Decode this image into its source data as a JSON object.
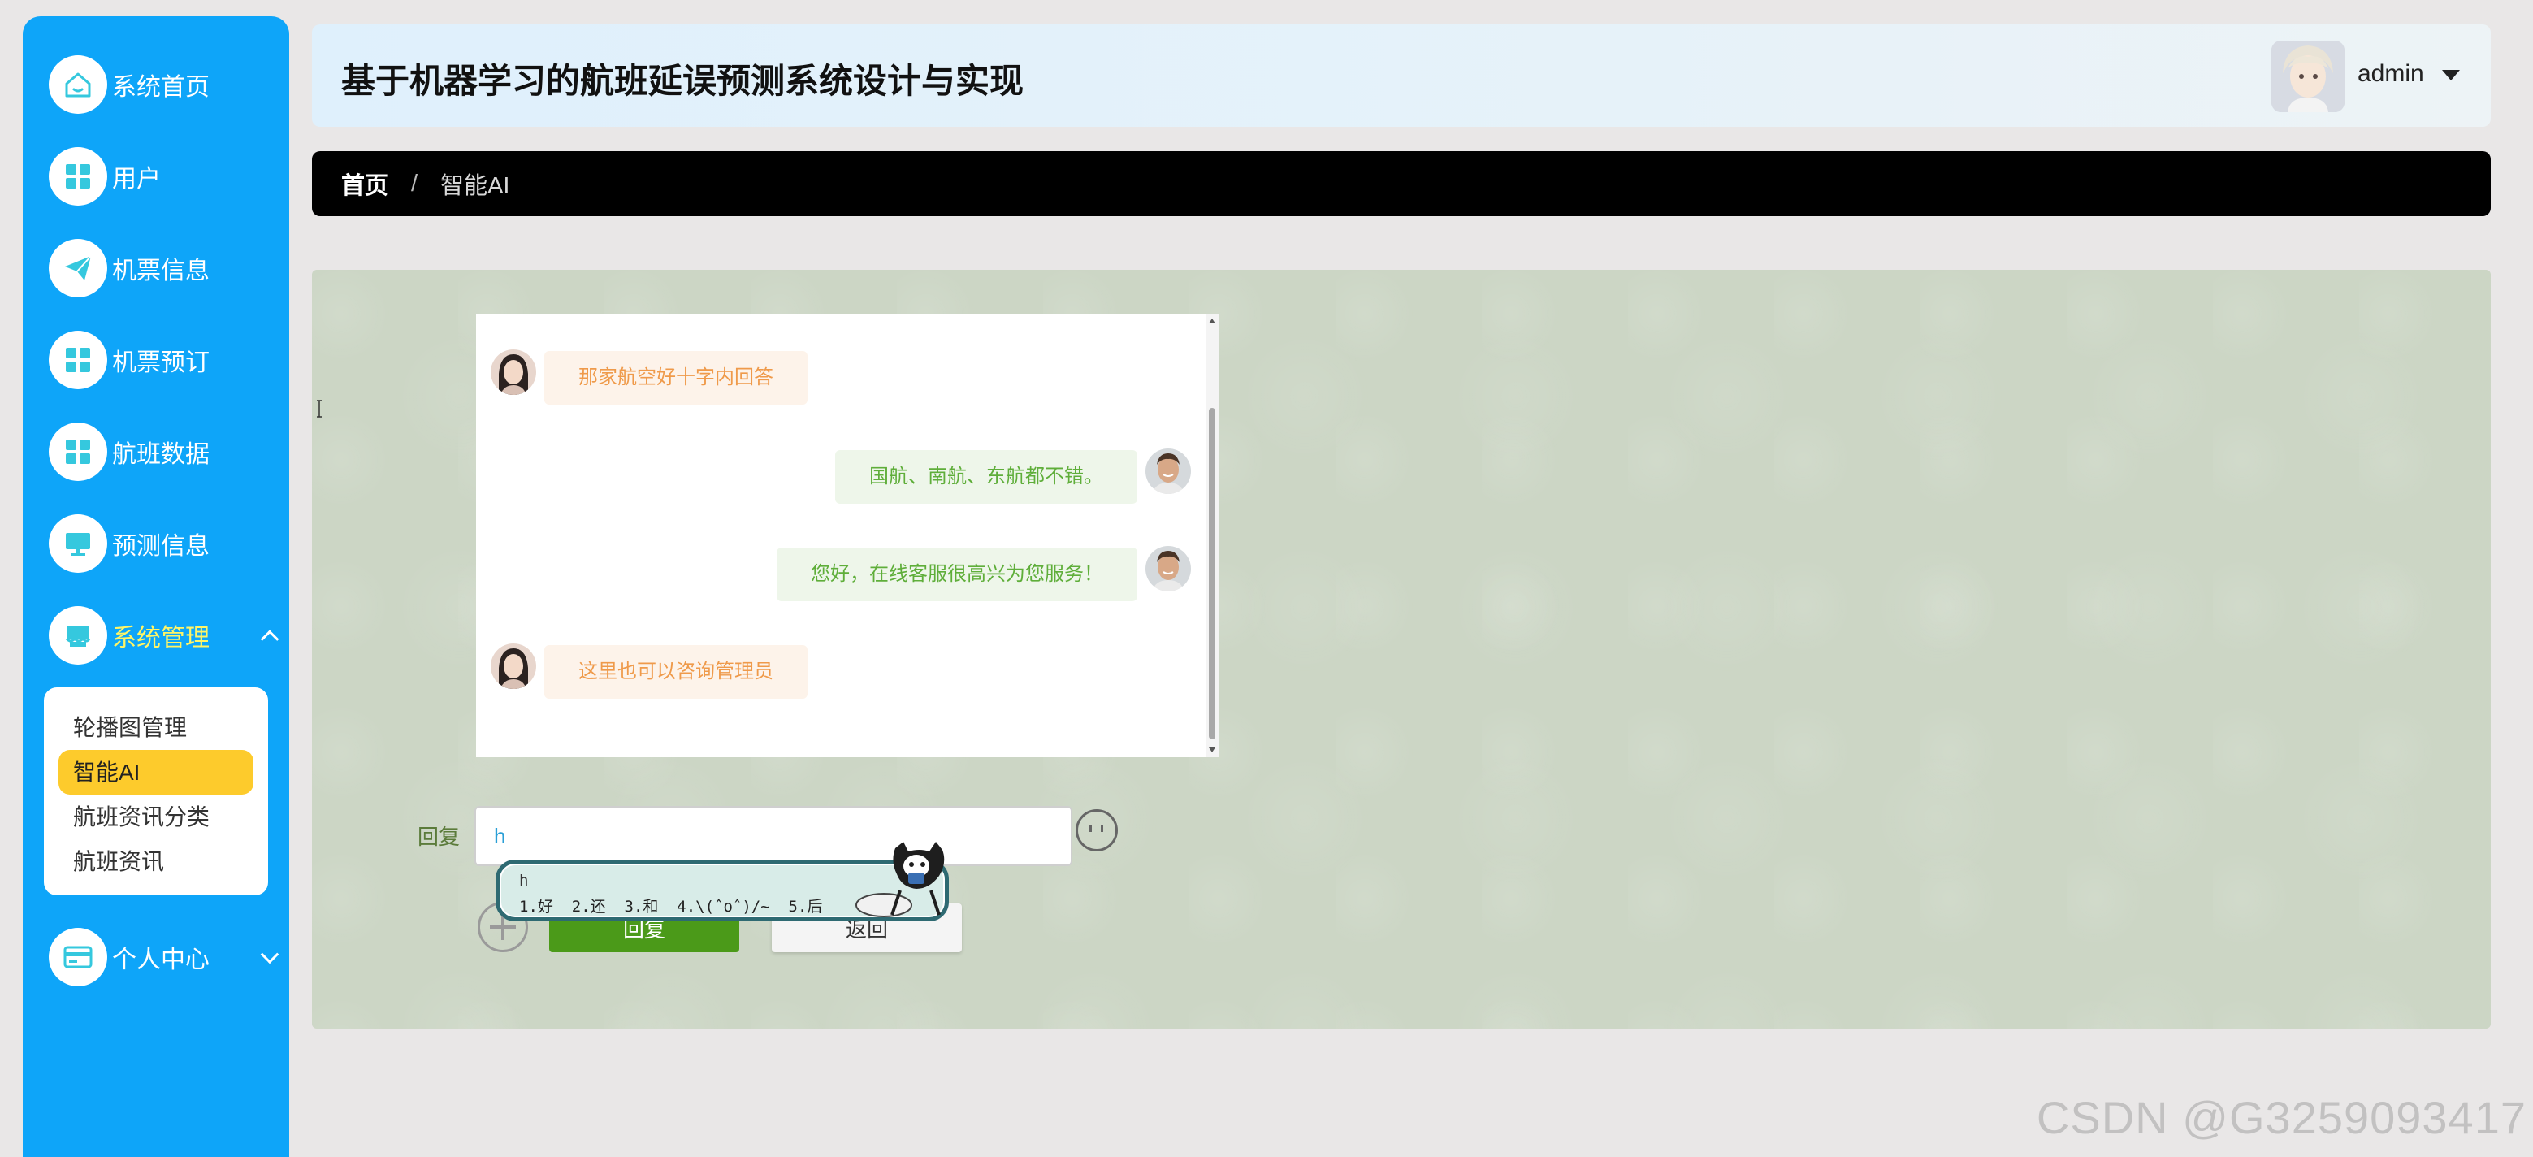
{
  "app": {
    "title": "基于机器学习的航班延误预测系统设计与实现",
    "username": "admin",
    "accent_color": "#0ea5f9",
    "active_submenu_color": "#fdcb2c"
  },
  "sidebar": {
    "items": [
      {
        "label": "系统首页",
        "icon": "home-icon"
      },
      {
        "label": "用户",
        "icon": "grid-icon"
      },
      {
        "label": "机票信息",
        "icon": "paper-plane-icon"
      },
      {
        "label": "机票预订",
        "icon": "grid-icon"
      },
      {
        "label": "航班数据",
        "icon": "grid-icon"
      },
      {
        "label": "预测信息",
        "icon": "monitor-icon"
      },
      {
        "label": "系统管理",
        "icon": "store-icon"
      },
      {
        "label": "个人中心",
        "icon": "card-icon"
      }
    ],
    "submenu": [
      {
        "label": "轮播图管理"
      },
      {
        "label": "智能AI"
      },
      {
        "label": "航班资讯分类"
      },
      {
        "label": "航班资讯"
      }
    ]
  },
  "breadcrumb": {
    "home": "首页",
    "separator": "/",
    "current": "智能AI"
  },
  "chat": {
    "messages": [
      {
        "role": "service",
        "text": "那家航空好十字内回答"
      },
      {
        "role": "user",
        "text": "国航、南航、东航都不错。"
      },
      {
        "role": "user",
        "text": "您好，在线客服很高兴为您服务！"
      },
      {
        "role": "service",
        "text": "这里也可以咨询管理员"
      }
    ],
    "reply_label": "回复",
    "input_value": "h",
    "send_label": "回复",
    "back_label": "返回"
  },
  "ime": {
    "composition": "h",
    "candidates": "1.好  2.还  3.和  4.\\(ˆoˆ)/~  5.后"
  },
  "watermark": "CSDN @G3259093417"
}
